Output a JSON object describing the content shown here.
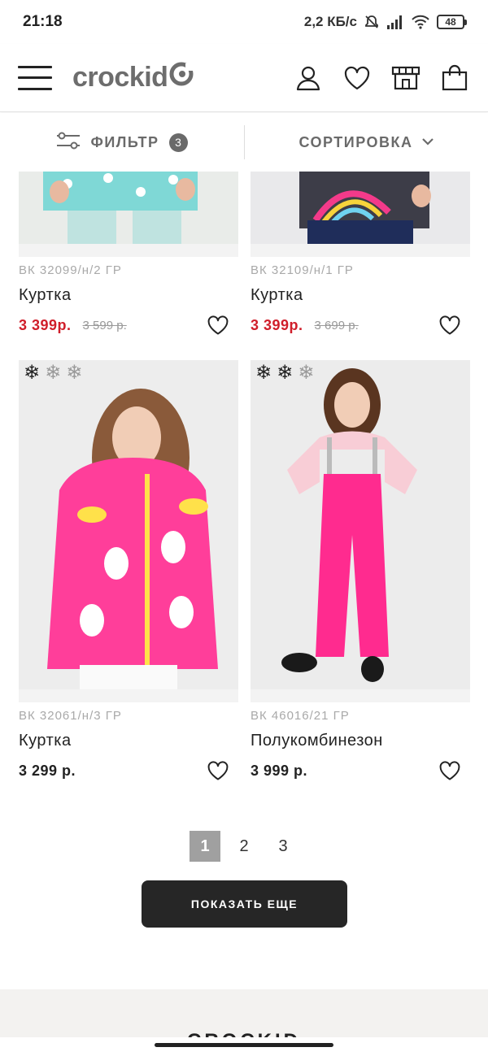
{
  "status_bar": {
    "time": "21:18",
    "network_speed": "2,2 КБ/с",
    "battery": "48",
    "icons": [
      "mute-icon",
      "signal-icon",
      "wifi-icon",
      "battery-icon"
    ]
  },
  "header": {
    "logo": "crockid",
    "icons": [
      "menu-icon",
      "user-icon",
      "heart-icon",
      "store-icon",
      "bag-icon"
    ]
  },
  "filter_bar": {
    "filter_label": "ФИЛЬТР",
    "filter_count": "3",
    "sort_label": "СОРТИРОВКА"
  },
  "products": [
    {
      "sku": "ВК 32099/н/2 ГР",
      "name": "Куртка",
      "price": "3 399р.",
      "old_price": "3 599 р.",
      "sale": true
    },
    {
      "sku": "ВК 32109/н/1 ГР",
      "name": "Куртка",
      "price": "3 399р.",
      "old_price": "3 699 р.",
      "sale": true
    },
    {
      "sku": "ВК 32061/н/3 ГР",
      "name": "Куртка",
      "price": "3 299 р.",
      "old_price": "",
      "sale": false,
      "snowflakes": {
        "active": 1,
        "total": 3
      }
    },
    {
      "sku": "ВК 46016/21 ГР",
      "name": "Полукомбинезон",
      "price": "3 999 р.",
      "old_price": "",
      "sale": false,
      "snowflakes": {
        "active": 2,
        "total": 3
      }
    }
  ],
  "pagination": {
    "pages": [
      "1",
      "2",
      "3"
    ],
    "current": "1"
  },
  "show_more_label": "ПОКАЗАТЬ ЕЩЕ",
  "footer": {
    "logo": "CROCKID"
  },
  "colors": {
    "sale_price": "#d01e2a",
    "button_bg": "#262626",
    "muted_text": "#a9a9a9"
  }
}
